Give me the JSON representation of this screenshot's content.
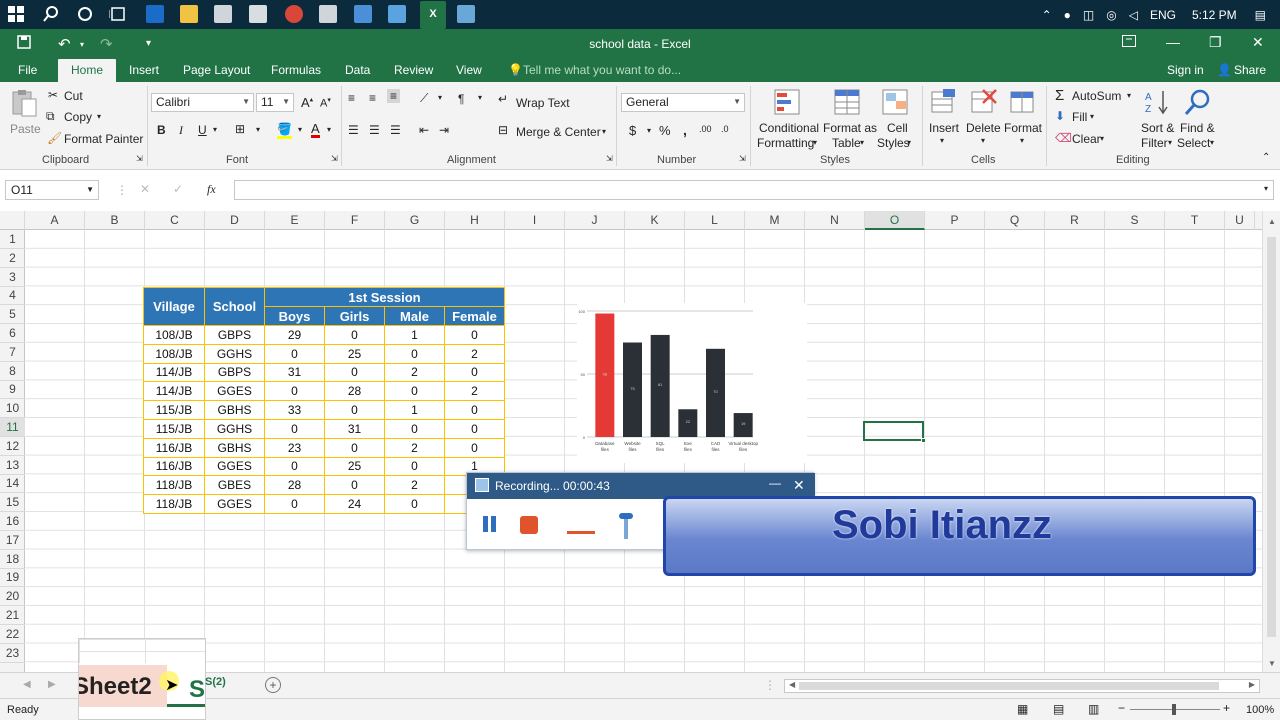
{
  "window": {
    "title": "school data - Excel"
  },
  "taskbar": {
    "tray_lang": "ENG",
    "tray_time": "5:12 PM"
  },
  "tabs": [
    "File",
    "Home",
    "Insert",
    "Page Layout",
    "Formulas",
    "Data",
    "Review",
    "View"
  ],
  "tell_me": "Tell me what you want to do...",
  "signin": "Sign in",
  "share": "Share",
  "ribbon": {
    "clipboard": {
      "label": "Clipboard",
      "paste": "Paste",
      "cut": "Cut",
      "copy": "Copy",
      "format_painter": "Format Painter"
    },
    "font": {
      "label": "Font",
      "name": "Calibri",
      "size": "11",
      "bold": "B",
      "italic": "I",
      "underline": "U"
    },
    "alignment": {
      "label": "Alignment",
      "wrap": "Wrap Text",
      "merge": "Merge & Center"
    },
    "number": {
      "label": "Number",
      "format": "General",
      "currency": "$",
      "percent": "%",
      "comma": ","
    },
    "styles": {
      "label": "Styles",
      "conditional": "Conditional",
      "conditional2": "Formatting",
      "format_table": "Format as",
      "format_table2": "Table",
      "cell_styles": "Cell",
      "cell_styles2": "Styles"
    },
    "cells": {
      "label": "Cells",
      "insert": "Insert",
      "delete": "Delete",
      "format": "Format"
    },
    "editing": {
      "label": "Editing",
      "autosum": "AutoSum",
      "fill": "Fill",
      "clear": "Clear",
      "sort": "Sort &",
      "sort2": "Filter",
      "find": "Find &",
      "find2": "Select"
    }
  },
  "formula_bar": {
    "name_box": "O11",
    "fx": "fx",
    "value": ""
  },
  "columns": [
    "A",
    "B",
    "C",
    "D",
    "E",
    "F",
    "G",
    "H",
    "I",
    "J",
    "K",
    "L",
    "M",
    "N",
    "O",
    "P",
    "Q",
    "R",
    "S",
    "T",
    "U"
  ],
  "rows": [
    "1",
    "2",
    "3",
    "4",
    "5",
    "6",
    "7",
    "8",
    "9",
    "10",
    "11",
    "12",
    "13",
    "14",
    "15",
    "16",
    "17",
    "18",
    "19",
    "20",
    "21",
    "22",
    "23"
  ],
  "table": {
    "h_village": "Village",
    "h_school": "School",
    "h_session": "1st Session",
    "subheaders": [
      "Boys",
      "Girls",
      "Male",
      "Female"
    ],
    "rows": [
      [
        "108/JB",
        "GBPS",
        "29",
        "0",
        "1",
        "0"
      ],
      [
        "108/JB",
        "GGHS",
        "0",
        "25",
        "0",
        "2"
      ],
      [
        "114/JB",
        "GBPS",
        "31",
        "0",
        "2",
        "0"
      ],
      [
        "114/JB",
        "GGES",
        "0",
        "28",
        "0",
        "2"
      ],
      [
        "115/JB",
        "GBHS",
        "33",
        "0",
        "1",
        "0"
      ],
      [
        "115/JB",
        "GGHS",
        "0",
        "31",
        "0",
        "0"
      ],
      [
        "116/JB",
        "GBHS",
        "23",
        "0",
        "2",
        "0"
      ],
      [
        "116/JB",
        "GGES",
        "0",
        "25",
        "0",
        "1"
      ],
      [
        "118/JB",
        "GBES",
        "28",
        "0",
        "2",
        ""
      ],
      [
        "118/JB",
        "GGES",
        "0",
        "24",
        "0",
        ""
      ]
    ]
  },
  "chart_data": {
    "type": "bar",
    "categories": [
      "Database files",
      "Website files",
      "SQL files",
      "Exe files",
      "CAD files",
      "Virtual desktop files"
    ],
    "values": [
      98,
      75,
      81,
      22,
      70,
      19
    ],
    "ylim": [
      0,
      100
    ],
    "title": "",
    "xlabel": "",
    "ylabel": "",
    "colors": [
      "#e53935",
      "#2b2f36",
      "#2b2f36",
      "#2b2f36",
      "#2b2f36",
      "#2b2f36"
    ]
  },
  "recording": {
    "title": "Recording... 00:00:43"
  },
  "banner": {
    "text": "Sobi Itianzz"
  },
  "sheets": {
    "tab1": "Sheet2",
    "tab2": "S(2)"
  },
  "status": {
    "ready": "Ready",
    "zoom": "100%"
  }
}
